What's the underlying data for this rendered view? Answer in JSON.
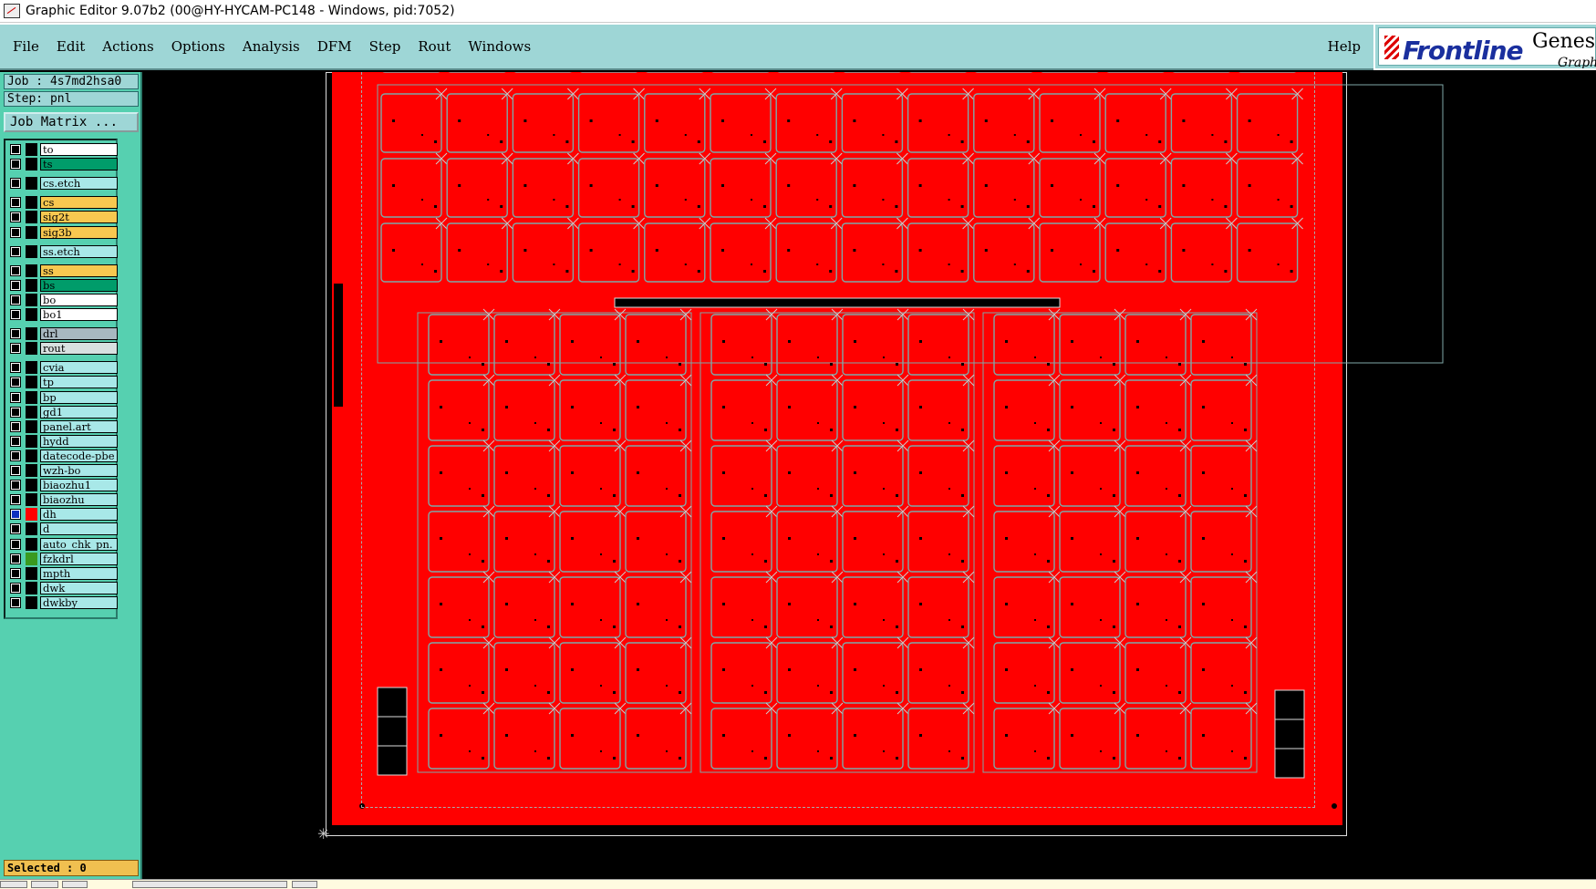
{
  "window": {
    "title": "Graphic Editor 9.07b2 (00@HY-HYCAM-PC148 - Windows, pid:7052)"
  },
  "menu": [
    "File",
    "Edit",
    "Actions",
    "Options",
    "Analysis",
    "DFM",
    "Step",
    "Rout",
    "Windows"
  ],
  "help": "Help",
  "logo": {
    "brand": "Frontline",
    "product": "Genesis",
    "sub": "Graphic"
  },
  "job": {
    "job_line": "Job : 4s7md2hsa0",
    "step_line": "Step: pnl",
    "matrix_button": "Job Matrix ..."
  },
  "colors": {
    "panel": "#56d0b0",
    "menubar": "#9ed6d6",
    "board_red": "#ff0000",
    "outline": "#7fa8a8",
    "white": "#ffffff",
    "green": "#009c6a",
    "yellow": "#f8c850",
    "gray": "#a8b8c0",
    "light": "#d8e0e0",
    "cyan": "#a8e8e8"
  },
  "layers": [
    {
      "name": "to",
      "color": "white",
      "swatch": "#000000",
      "checked": false
    },
    {
      "name": "ts",
      "color": "green",
      "swatch": "#000000",
      "checked": false
    },
    {
      "name": "cs.etch",
      "color": "cyan",
      "swatch": "#000000",
      "checked": false,
      "gap": true
    },
    {
      "name": "cs",
      "color": "yellow",
      "swatch": "#000000",
      "checked": false,
      "gap": true
    },
    {
      "name": "sig2t",
      "color": "yellow",
      "swatch": "#000000",
      "checked": false
    },
    {
      "name": "sig3b",
      "color": "yellow",
      "swatch": "#000000",
      "checked": false
    },
    {
      "name": "ss.etch",
      "color": "cyan",
      "swatch": "#000000",
      "checked": false,
      "gap": true
    },
    {
      "name": "ss",
      "color": "yellow",
      "swatch": "#000000",
      "checked": false,
      "gap": true
    },
    {
      "name": "bs",
      "color": "green",
      "swatch": "#000000",
      "checked": false
    },
    {
      "name": "bo",
      "color": "white",
      "swatch": "#000000",
      "checked": false
    },
    {
      "name": "bo1",
      "color": "white",
      "swatch": "#000000",
      "checked": false
    },
    {
      "name": "drl",
      "color": "gray",
      "swatch": "#000000",
      "checked": false,
      "gap": true
    },
    {
      "name": "rout",
      "color": "light",
      "swatch": "#000000",
      "checked": false
    },
    {
      "name": "cvia",
      "color": "cyan",
      "swatch": "#000000",
      "checked": false,
      "gap": true
    },
    {
      "name": "tp",
      "color": "cyan",
      "swatch": "#000000",
      "checked": false
    },
    {
      "name": "bp",
      "color": "cyan",
      "swatch": "#000000",
      "checked": false
    },
    {
      "name": "gd1",
      "color": "cyan",
      "swatch": "#000000",
      "checked": false
    },
    {
      "name": "panel.art",
      "color": "cyan",
      "swatch": "#000000",
      "checked": false
    },
    {
      "name": "hydd",
      "color": "cyan",
      "swatch": "#000000",
      "checked": false
    },
    {
      "name": "datecode-pbe",
      "color": "cyan",
      "swatch": "#000000",
      "checked": false
    },
    {
      "name": "wzh-bo",
      "color": "cyan",
      "swatch": "#000000",
      "checked": false
    },
    {
      "name": "biaozhu1",
      "color": "cyan",
      "swatch": "#000000",
      "checked": false
    },
    {
      "name": "biaozhu",
      "color": "cyan",
      "swatch": "#000000",
      "checked": false
    },
    {
      "name": "dh",
      "color": "cyan",
      "swatch": "#ff0000",
      "checked": true
    },
    {
      "name": "d",
      "color": "cyan",
      "swatch": "#000000",
      "checked": false
    },
    {
      "name": "auto_chk_pn.",
      "color": "cyan",
      "swatch": "#000000",
      "checked": false
    },
    {
      "name": "fzkdrl",
      "color": "cyan",
      "swatch": "#3a9a20",
      "checked": false
    },
    {
      "name": "mpth",
      "color": "cyan",
      "swatch": "#000000",
      "checked": false
    },
    {
      "name": "dwk",
      "color": "cyan",
      "swatch": "#000000",
      "checked": false
    },
    {
      "name": "dwkby",
      "color": "cyan",
      "swatch": "#000000",
      "checked": false
    }
  ],
  "status": "Selected : 0"
}
